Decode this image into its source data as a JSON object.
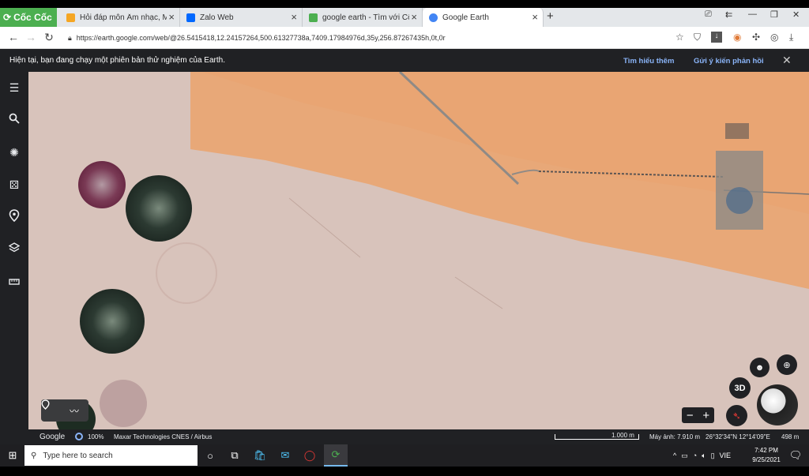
{
  "browser": {
    "brand": "Cốc Cốc",
    "tabs": [
      {
        "title": "Hỏi đáp môn Âm nhạc, Mỹ t",
        "icon": "hoidap-favicon-icon",
        "color": "#f5a623"
      },
      {
        "title": "Zalo Web",
        "icon": "zalo-favicon-icon",
        "color": "#0068ff"
      },
      {
        "title": "google earth - Tìm với Cốc C",
        "icon": "coccoc-favicon-icon",
        "color": "#4caf50"
      },
      {
        "title": "Google Earth",
        "icon": "earth-favicon-icon",
        "color": "#4285f4"
      }
    ],
    "url": "https://earth.google.com/web/@26.5415418,12.24157264,500.61327738a,7409.17984976d,35y,256.87267435h,0t,0r"
  },
  "banner": {
    "message": "Hiện tại, bạn đang chạy một phiên bản thử nghiệm của Earth.",
    "learn_more": "Tìm hiểu thêm",
    "feedback": "Gửi ý kiến phản hồi"
  },
  "sidebar": {
    "items": [
      {
        "name": "menu-icon"
      },
      {
        "name": "search-icon"
      },
      {
        "name": "voyager-icon"
      },
      {
        "name": "feeling-lucky-icon"
      },
      {
        "name": "projects-icon"
      },
      {
        "name": "map-style-icon"
      },
      {
        "name": "measure-icon"
      }
    ]
  },
  "controls": {
    "three_d": "3D"
  },
  "status": {
    "google": "Google",
    "load": "100%",
    "credits": "Maxar Technologies  CNES / Airbus",
    "scale": "1.000 m",
    "camera": "Máy ảnh: 7.910 m",
    "coords": "26°32'34\"N 12°14'09\"E",
    "elevation": "498 m"
  },
  "taskbar": {
    "search_placeholder": "Type here to search",
    "language": "VIE",
    "time": "7:42 PM",
    "date": "9/25/2021"
  }
}
